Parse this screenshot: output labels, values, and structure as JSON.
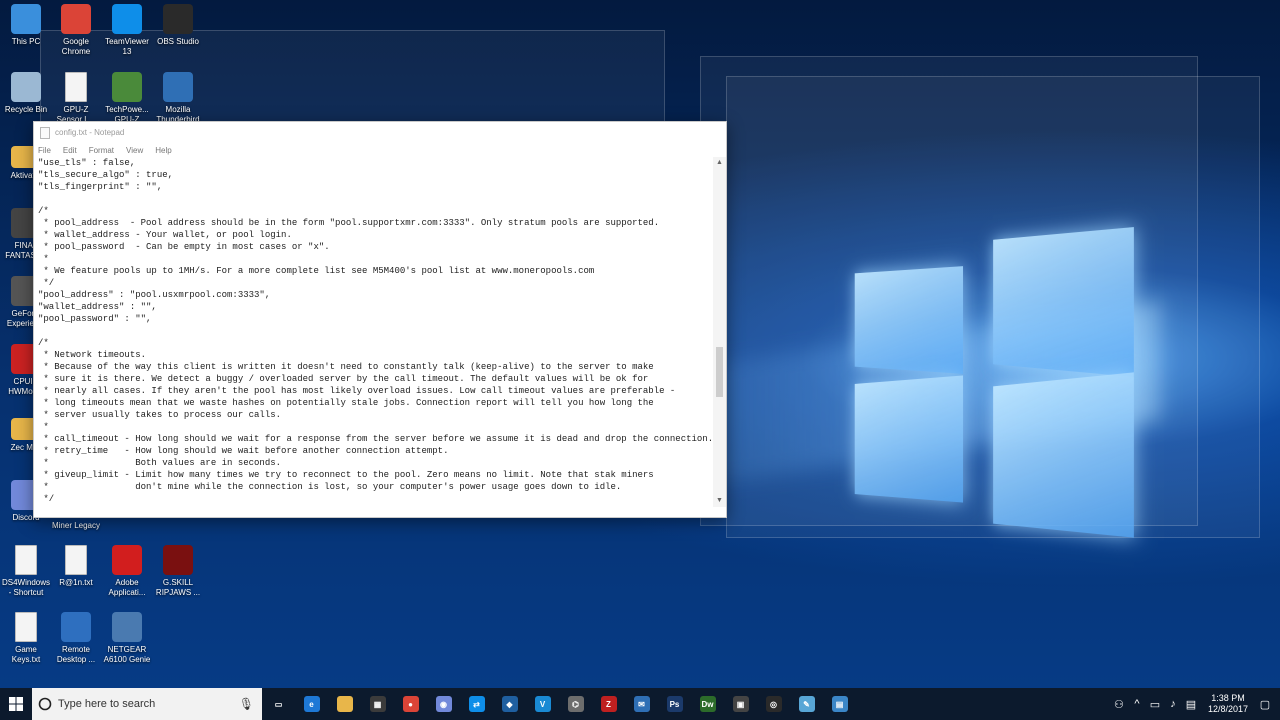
{
  "desktop_icons": [
    {
      "label": "This PC",
      "icon": "computer-icon",
      "color": "#3a8fdc"
    },
    {
      "label": "Google Chrome",
      "icon": "chrome-icon",
      "color": "#db4437"
    },
    {
      "label": "TeamViewer 13",
      "icon": "teamviewer-icon",
      "color": "#0e8ee9"
    },
    {
      "label": "OBS Studio",
      "icon": "obs-icon",
      "color": "#2a2a2a"
    },
    {
      "label": "Recycle Bin",
      "icon": "recycle-bin-icon",
      "color": "#9bb8d3"
    },
    {
      "label": "GPU-Z Sensor L...",
      "icon": "text-file-icon",
      "color": "#f4f4f4"
    },
    {
      "label": "TechPowe... GPU-Z",
      "icon": "gpuz-icon",
      "color": "#4a8a3a"
    },
    {
      "label": "Mozilla Thunderbird",
      "icon": "thunderbird-icon",
      "color": "#2f6fb5"
    },
    {
      "label": "Aktivat...",
      "icon": "folder-icon",
      "color": "#e8b64a"
    },
    {
      "label": "FINAL FANTASY...",
      "icon": "game-icon",
      "color": "#444"
    },
    {
      "label": "GeFor... Experien...",
      "icon": "geforce-icon",
      "color": "#555"
    },
    {
      "label": "CPUID HWMon...",
      "icon": "hwmonitor-icon",
      "color": "#c22"
    },
    {
      "label": "Zec Mi...",
      "icon": "folder-icon",
      "color": "#e8b64a"
    },
    {
      "label": "Discord",
      "icon": "discord-icon",
      "color": "#7289da"
    },
    {
      "label": "Miner Legacy",
      "icon": "folder-icon",
      "color": "#e8b64a"
    },
    {
      "label": "DS4Windows - Shortcut",
      "icon": "text-file-icon",
      "color": "#f4f4f4"
    },
    {
      "label": "R@1n.txt",
      "icon": "text-file-icon",
      "color": "#f4f4f4"
    },
    {
      "label": "Adobe Applicati...",
      "icon": "adobe-icon",
      "color": "#d21e1e"
    },
    {
      "label": "G.SKILL RIPJAWS ...",
      "icon": "gskill-icon",
      "color": "#7a1010"
    },
    {
      "label": "Game Keys.txt",
      "icon": "text-file-icon",
      "color": "#f4f4f4"
    },
    {
      "label": "Remote Desktop ...",
      "icon": "remote-desktop-icon",
      "color": "#2e6fbf"
    },
    {
      "label": "NETGEAR A6100 Genie",
      "icon": "netgear-icon",
      "color": "#4a7ab0"
    }
  ],
  "notepad": {
    "title": "config.txt - Notepad",
    "menu": [
      "File",
      "Edit",
      "Format",
      "View",
      "Help"
    ],
    "lines": [
      "\"use_tls\" : false,",
      "\"tls_secure_algo\" : true,",
      "\"tls_fingerprint\" : \"\",",
      "",
      "/*",
      " * pool_address  - Pool address should be in the form \"pool.supportxmr.com:3333\". Only stratum pools are supported.",
      " * wallet_address - Your wallet, or pool login.",
      " * pool_password  - Can be empty in most cases or \"x\".",
      " *",
      " * We feature pools up to 1MH/s. For a more complete list see M5M400's pool list at www.moneropools.com",
      " */",
      "\"pool_address\" : \"pool.usxmrpool.com:3333\",",
      "\"wallet_address\" : \"\",",
      "\"pool_password\" : \"\",",
      "",
      "/*",
      " * Network timeouts.",
      " * Because of the way this client is written it doesn't need to constantly talk (keep-alive) to the server to make",
      " * sure it is there. We detect a buggy / overloaded server by the call timeout. The default values will be ok for",
      " * nearly all cases. If they aren't the pool has most likely overload issues. Low call timeout values are preferable -",
      " * long timeouts mean that we waste hashes on potentially stale jobs. Connection report will tell you how long the",
      " * server usually takes to process our calls.",
      " *",
      " * call_timeout - How long should we wait for a response from the server before we assume it is dead and drop the connection.",
      " * retry_time   - How long should we wait before another connection attempt.",
      " *                Both values are in seconds.",
      " * giveup_limit - Limit how many times we try to reconnect to the pool. Zero means no limit. Note that stak miners",
      " *                don't mine while the connection is lost, so your computer's power usage goes down to idle.",
      " */"
    ]
  },
  "taskbar": {
    "search_placeholder": "Type here to search",
    "apps": [
      {
        "icon": "task-view-icon",
        "color": "#0c1a2d",
        "glyph": "▭"
      },
      {
        "icon": "edge-icon",
        "color": "#1e78d6",
        "glyph": "e"
      },
      {
        "icon": "file-explorer-icon",
        "color": "#e8b64a",
        "glyph": ""
      },
      {
        "icon": "calculator-icon",
        "color": "#3b3b3b",
        "glyph": "▦"
      },
      {
        "icon": "chrome-icon",
        "color": "#db4437",
        "glyph": "●"
      },
      {
        "icon": "discord-icon",
        "color": "#7289da",
        "glyph": "◉"
      },
      {
        "icon": "teamviewer-icon",
        "color": "#0e8ee9",
        "glyph": "⇄"
      },
      {
        "icon": "3d-box-icon",
        "color": "#1f5fa0",
        "glyph": "◆"
      },
      {
        "icon": "vs-code-icon",
        "color": "#1a8ad4",
        "glyph": "V"
      },
      {
        "icon": "network-tool-icon",
        "color": "#6d6d6d",
        "glyph": "⌬"
      },
      {
        "icon": "filezilla-icon",
        "color": "#bf2020",
        "glyph": "Z"
      },
      {
        "icon": "thunderbird-icon",
        "color": "#2f6fb5",
        "glyph": "✉"
      },
      {
        "icon": "photoshop-icon",
        "color": "#1b3a6b",
        "glyph": "Ps"
      },
      {
        "icon": "dreamweaver-icon",
        "color": "#2c6b2a",
        "glyph": "Dw"
      },
      {
        "icon": "video-editor-icon",
        "color": "#444",
        "glyph": "▣"
      },
      {
        "icon": "obs-icon",
        "color": "#2a2a2a",
        "glyph": "◎"
      },
      {
        "icon": "paint-icon",
        "color": "#58a6d6",
        "glyph": "✎"
      },
      {
        "icon": "notepad-icon",
        "color": "#3b86c7",
        "glyph": "▤"
      }
    ],
    "time": "1:38 PM",
    "date": "12/8/2017"
  }
}
